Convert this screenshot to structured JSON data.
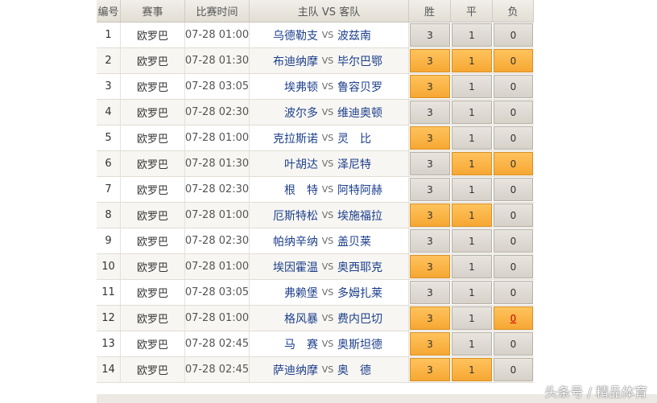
{
  "header": {
    "no": "编号",
    "competition": "赛事",
    "time": "比赛时间",
    "match": "主队 VS 客队",
    "win": "胜",
    "draw": "平",
    "loss": "负"
  },
  "rows": [
    {
      "no": "1",
      "competition": "欧罗巴",
      "time": "07-28 01:00",
      "home": "乌德勒支",
      "vs": "VS",
      "away": "波兹南",
      "win": "3",
      "draw": "1",
      "loss": "0",
      "selected": []
    },
    {
      "no": "2",
      "competition": "欧罗巴",
      "time": "07-28 01:30",
      "home": "布迪纳摩",
      "vs": "VS",
      "away": "毕尔巴鄂",
      "win": "3",
      "draw": "1",
      "loss": "0",
      "selected": [
        "win",
        "draw",
        "loss"
      ]
    },
    {
      "no": "3",
      "competition": "欧罗巴",
      "time": "07-28 03:05",
      "home": "埃弗顿",
      "vs": "VS",
      "away": "鲁容贝罗",
      "win": "3",
      "draw": "1",
      "loss": "0",
      "selected": [
        "win"
      ]
    },
    {
      "no": "4",
      "competition": "欧罗巴",
      "time": "07-28 02:30",
      "home": "波尔多",
      "vs": "VS",
      "away": "维迪奥顿",
      "win": "3",
      "draw": "1",
      "loss": "0",
      "selected": []
    },
    {
      "no": "5",
      "competition": "欧罗巴",
      "time": "07-28 01:00",
      "home": "克拉斯诺",
      "vs": "VS",
      "away": "灵　比",
      "win": "3",
      "draw": "1",
      "loss": "0",
      "selected": [
        "win"
      ]
    },
    {
      "no": "6",
      "competition": "欧罗巴",
      "time": "07-28 01:30",
      "home": "叶胡达",
      "vs": "VS",
      "away": "泽尼特",
      "win": "3",
      "draw": "1",
      "loss": "0",
      "selected": [
        "draw",
        "loss"
      ]
    },
    {
      "no": "7",
      "competition": "欧罗巴",
      "time": "07-28 02:30",
      "home": "根　特",
      "vs": "VS",
      "away": "阿特阿赫",
      "win": "3",
      "draw": "1",
      "loss": "0",
      "selected": []
    },
    {
      "no": "8",
      "competition": "欧罗巴",
      "time": "07-28 01:00",
      "home": "厄斯特松",
      "vs": "VS",
      "away": "埃施福拉",
      "win": "3",
      "draw": "1",
      "loss": "0",
      "selected": [
        "win",
        "draw"
      ]
    },
    {
      "no": "9",
      "competition": "欧罗巴",
      "time": "07-28 02:30",
      "home": "帕纳辛纳",
      "vs": "VS",
      "away": "盖贝莱",
      "win": "3",
      "draw": "1",
      "loss": "0",
      "selected": []
    },
    {
      "no": "10",
      "competition": "欧罗巴",
      "time": "07-28 01:00",
      "home": "埃因霍温",
      "vs": "VS",
      "away": "奥西耶克",
      "win": "3",
      "draw": "1",
      "loss": "0",
      "selected": [
        "win"
      ]
    },
    {
      "no": "11",
      "competition": "欧罗巴",
      "time": "07-28 03:05",
      "home": "弗赖堡",
      "vs": "VS",
      "away": "多姆扎莱",
      "win": "3",
      "draw": "1",
      "loss": "0",
      "selected": []
    },
    {
      "no": "12",
      "competition": "欧罗巴",
      "time": "07-28 01:00",
      "home": "格风暴",
      "vs": "VS",
      "away": "费内巴切",
      "win": "3",
      "draw": "1",
      "loss": "0",
      "selected": [
        "win",
        "loss"
      ],
      "underline": "loss"
    },
    {
      "no": "13",
      "competition": "欧罗巴",
      "time": "07-28 02:45",
      "home": "马　赛",
      "vs": "VS",
      "away": "奥斯坦德",
      "win": "3",
      "draw": "1",
      "loss": "0",
      "selected": [
        "win"
      ]
    },
    {
      "no": "14",
      "competition": "欧罗巴",
      "time": "07-28 02:45",
      "home": "萨迪纳摩",
      "vs": "VS",
      "away": "奥　德",
      "win": "3",
      "draw": "1",
      "loss": "0",
      "selected": [
        "win",
        "draw"
      ]
    }
  ],
  "watermark": "头条号 / 精品体育"
}
